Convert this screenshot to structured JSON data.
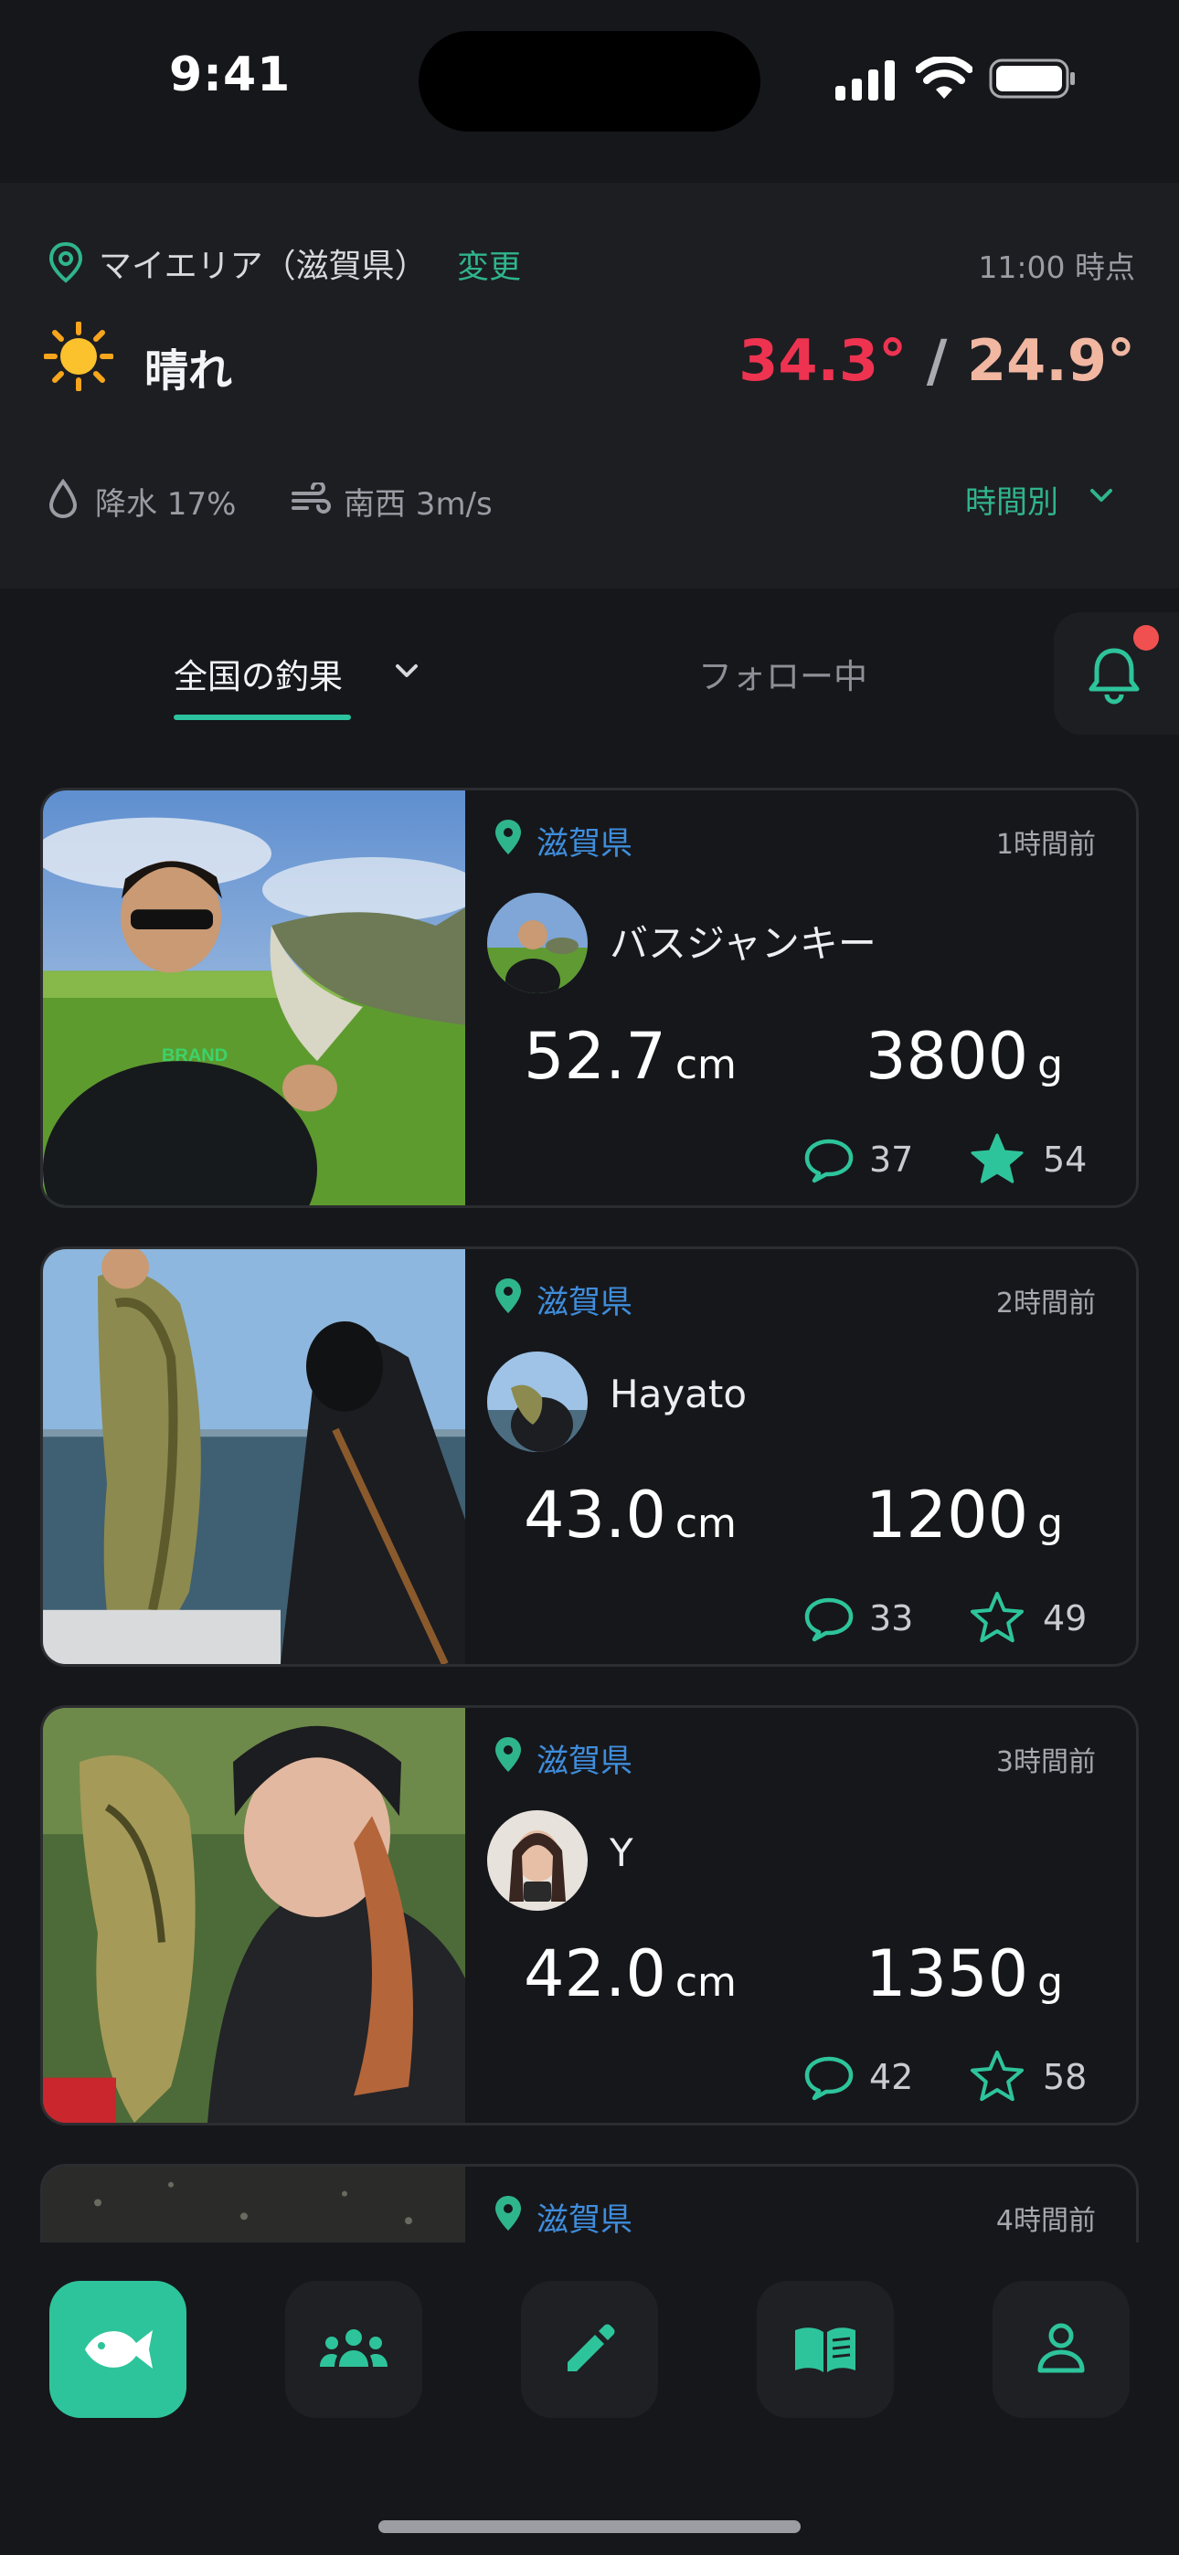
{
  "status_bar": {
    "time": "9:41"
  },
  "weather": {
    "area_label": "マイエリア（滋賀県）",
    "change_label": "変更",
    "as_of": "11:00 時点",
    "condition": "晴れ",
    "high": "34.3°",
    "separator": "/",
    "low": "24.9°",
    "precip": "降水 17%",
    "wind": "南西 3m/s",
    "hourly_label": "時間別",
    "colors": {
      "high": "#ee3350",
      "low": "#f1b7a1",
      "accent": "#2fb58c"
    }
  },
  "tabs": {
    "national": "全国の釣果",
    "following": "フォロー中"
  },
  "feed": [
    {
      "pref": "滋賀県",
      "ago": "1時間前",
      "user": "バスジャンキー",
      "length": "52.7",
      "length_unit": "cm",
      "weight": "3800",
      "weight_unit": "g",
      "comments": "37",
      "favorites": "54",
      "starred": true
    },
    {
      "pref": "滋賀県",
      "ago": "2時間前",
      "user": "Hayato",
      "length": "43.0",
      "length_unit": "cm",
      "weight": "1200",
      "weight_unit": "g",
      "comments": "33",
      "favorites": "49",
      "starred": false
    },
    {
      "pref": "滋賀県",
      "ago": "3時間前",
      "user": "Y",
      "length": "42.0",
      "length_unit": "cm",
      "weight": "1350",
      "weight_unit": "g",
      "comments": "42",
      "favorites": "58",
      "starred": false
    },
    {
      "pref": "滋賀県",
      "ago": "4時間前"
    }
  ],
  "nav": {
    "items": [
      "fish-icon",
      "community-icon",
      "edit-icon",
      "book-icon",
      "profile-icon"
    ],
    "active": "fish-icon",
    "accent": "#2ec49b"
  }
}
